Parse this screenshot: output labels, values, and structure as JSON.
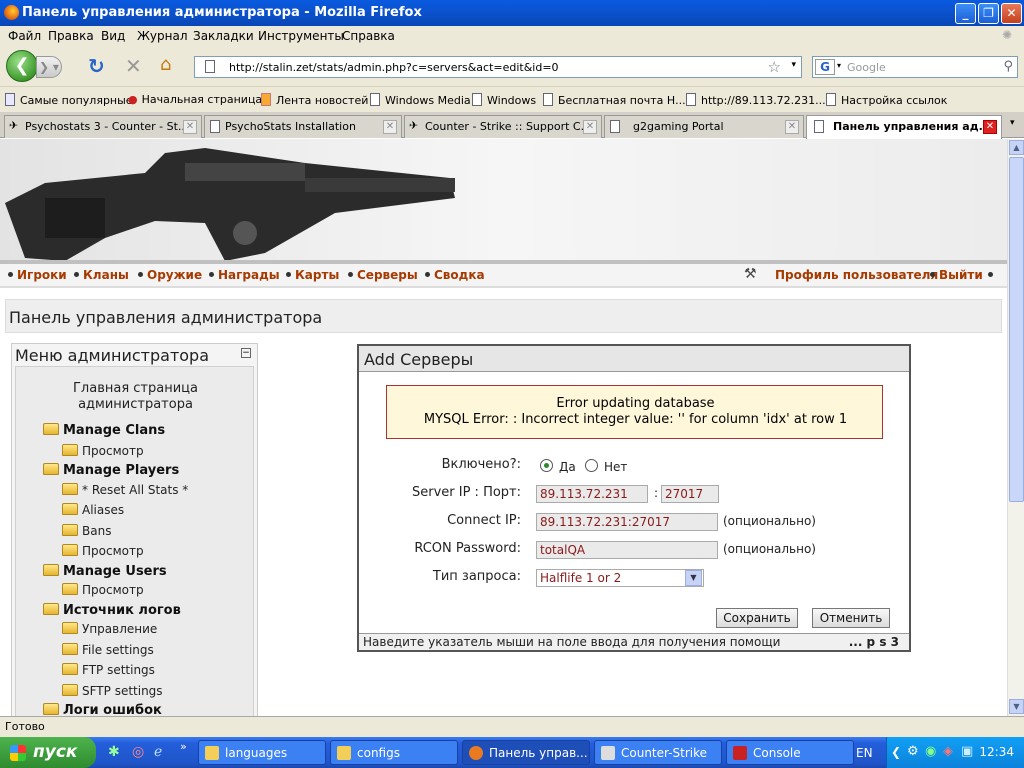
{
  "window": {
    "title": "Панель управления администратора - Mozilla Firefox"
  },
  "menubar": [
    "Файл",
    "Правка",
    "Вид",
    "Журнал",
    "Закладки",
    "Инструменты",
    "Справка"
  ],
  "urlbar": {
    "url": "http://stalin.zet/stats/admin.php?c=servers&act=edit&id=0"
  },
  "search": {
    "placeholder": "Google"
  },
  "bookmarks": [
    "Самые популярные",
    "Начальная страница",
    "Лента новостей",
    "Windows Media",
    "Windows",
    "Бесплатная почта Н...",
    "http://89.113.72.231...",
    "Настройка ссылок"
  ],
  "tabs": [
    {
      "label": "Psychostats 3 - Counter - St..."
    },
    {
      "label": "PsychoStats Installation"
    },
    {
      "label": "Counter - Strike :: Support C..."
    },
    {
      "label": "g2gaming Portal"
    },
    {
      "label": "Панель управления ад..."
    }
  ],
  "sitenav": {
    "items": [
      "Игроки",
      "Кланы",
      "Оружие",
      "Награды",
      "Карты",
      "Серверы",
      "Сводка"
    ],
    "profile": "Профиль пользователя",
    "logout": "Выйти"
  },
  "page": {
    "title": "Панель управления администратора"
  },
  "adminmenu": {
    "heading": "Меню администратора",
    "collapse": "−",
    "home_line1": "Главная страница",
    "home_line2": "администратора",
    "items": [
      {
        "label": "Manage Clans",
        "level": 0
      },
      {
        "label": "Просмотр",
        "level": 1
      },
      {
        "label": "Manage Players",
        "level": 0
      },
      {
        "label": "* Reset All Stats *",
        "level": 1
      },
      {
        "label": "Aliases",
        "level": 1
      },
      {
        "label": "Bans",
        "level": 1
      },
      {
        "label": "Просмотр",
        "level": 1
      },
      {
        "label": "Manage Users",
        "level": 0
      },
      {
        "label": "Просмотр",
        "level": 1
      },
      {
        "label": "Источник логов",
        "level": 0
      },
      {
        "label": "Управление",
        "level": 1
      },
      {
        "label": "File settings",
        "level": 1
      },
      {
        "label": "FTP settings",
        "level": 1
      },
      {
        "label": "SFTP settings",
        "level": 1
      },
      {
        "label": "Логи ошибок",
        "level": 0
      }
    ]
  },
  "form": {
    "heading": "Add Серверы",
    "error_title": "Error updating database",
    "error_msg": "MYSQL Error: : Incorrect integer value: '' for column 'idx' at row 1",
    "enabled_label": "Включено?:",
    "yes": "Да",
    "no": "Нет",
    "enabled_value": "yes",
    "ip_label": "Server IP : Порт:",
    "ip_value": "89.113.72.231",
    "port_sep": ":",
    "port_value": "27017",
    "connect_label": "Connect IP:",
    "connect_value": "89.113.72.231:27017",
    "optional": "(опционально)",
    "rcon_label": "RCON Password:",
    "rcon_value": "totalQA",
    "query_label": "Тип запроса:",
    "query_value": "Halflife 1 or 2",
    "save": "Сохранить",
    "cancel": "Отменить",
    "hint": "Наведите указатель мыши на поле ввода для получения помощи",
    "footer_right": "... p s 3"
  },
  "statusbar": {
    "text": "Готово"
  },
  "taskbar": {
    "start": "пуск",
    "tasks": [
      {
        "label": "languages"
      },
      {
        "label": "configs"
      },
      {
        "label": "Панель управ..."
      },
      {
        "label": "Counter-Strike"
      },
      {
        "label": "Console"
      }
    ],
    "lang": "EN",
    "clock": "12:34"
  }
}
